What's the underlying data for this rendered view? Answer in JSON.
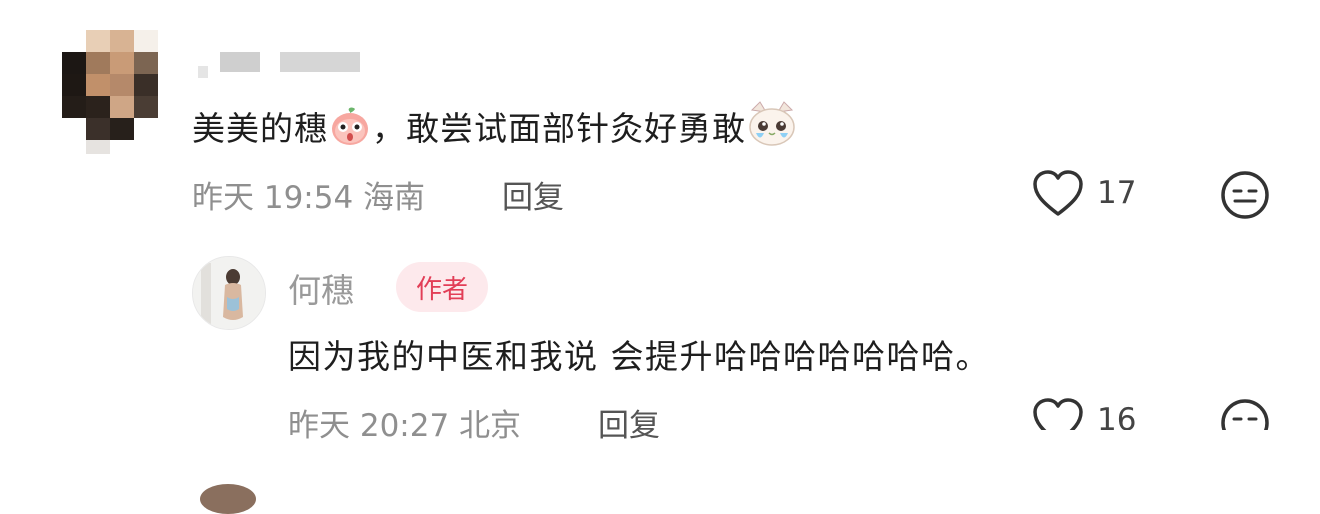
{
  "comments": [
    {
      "text_before_emoji": "美美的穗",
      "emoji1": "peach-face-emoji",
      "text_after_emoji": "，敢尝试面部针灸好勇敢",
      "emoji2": "crying-cat-emoji",
      "date": "昨天",
      "time": "19:54",
      "location": "海南",
      "reply_label": "回复",
      "likes": "17"
    },
    {
      "author_name": "何穗",
      "author_tag": "作者",
      "text": "因为我的中医和我说 会提升哈哈哈哈哈哈哈。",
      "date": "昨天",
      "time": "20:27",
      "location": "北京",
      "reply_label": "回复",
      "likes": "16"
    }
  ],
  "colors": {
    "author_tag_bg": "#fde9ec",
    "author_tag_text": "#e23e57",
    "meta_text": "#8f8f8f"
  }
}
